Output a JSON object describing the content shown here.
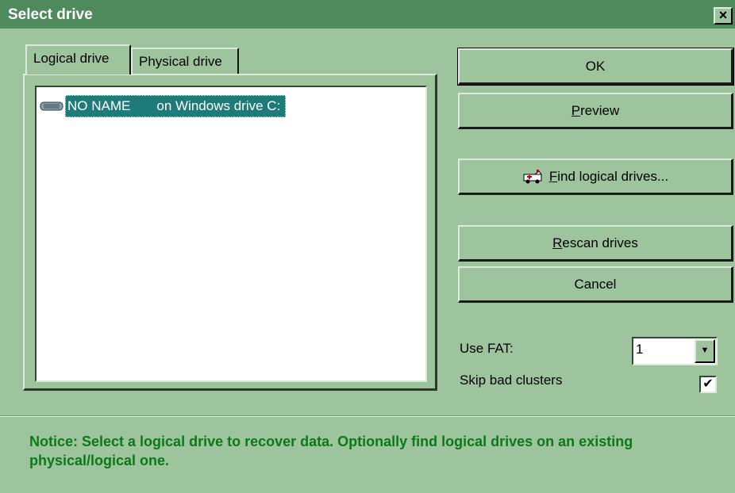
{
  "window": {
    "title": "Select drive",
    "close_glyph": "×"
  },
  "tabs": [
    {
      "label": "Logical drive",
      "active": true
    },
    {
      "label": "Physical drive",
      "active": false
    }
  ],
  "drive_list": {
    "items": [
      {
        "icon": "drive-icon",
        "label": "NO NAME       on Windows drive C:",
        "selected": true
      }
    ]
  },
  "buttons": {
    "ok": "OK",
    "preview": {
      "mnemonic": "P",
      "rest": "review"
    },
    "find": {
      "mnemonic": "F",
      "rest": "ind logical drives...",
      "icon": "ambulance-icon"
    },
    "rescan": {
      "mnemonic": "R",
      "rest": "escan drives"
    },
    "cancel": "Cancel"
  },
  "options": {
    "use_fat_label": "Use FAT:",
    "use_fat_value": "1",
    "skip_bad_label": "Skip bad clusters",
    "skip_bad_checked": true,
    "check_glyph": "✔"
  },
  "notice": "Notice: Select a logical drive to recover data. Optionally find logical drives on an existing physical/logical one.",
  "colors": {
    "background": "#9ec49e",
    "titlebar": "#4e8a5c",
    "selection": "#1f7a7a",
    "notice_text": "#0a7a16"
  }
}
